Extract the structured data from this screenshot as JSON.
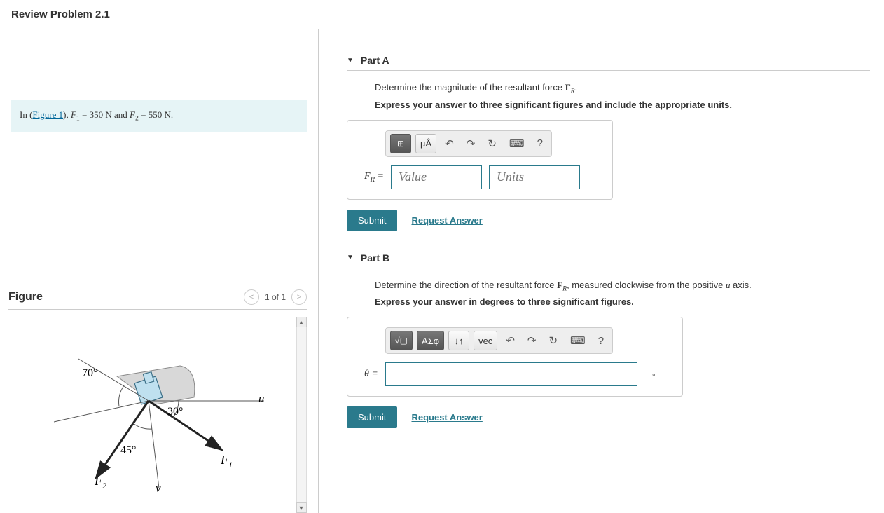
{
  "page_title": "Review Problem 2.1",
  "info": {
    "prefix": "In (",
    "figure_link": "Figure 1",
    "after_link": "), ",
    "f1_var": "F",
    "f1_sub": "1",
    "f1_eq": " = 350 N and ",
    "f2_var": "F",
    "f2_sub": "2",
    "f2_eq": " = 550 N."
  },
  "figure": {
    "heading": "Figure",
    "pager": "1 of 1",
    "angle1": "70°",
    "angle2": "30°",
    "angle3": "45°",
    "axis_u": "u",
    "axis_v": "v",
    "label_f1": "F",
    "label_f1_sub": "1",
    "label_f2": "F",
    "label_f2_sub": "2"
  },
  "parts": {
    "a": {
      "title": "Part A",
      "question_pre": "Determine the magnitude of the resultant force ",
      "question_var": "F",
      "question_sub": "R",
      "question_post": ".",
      "instruction": "Express your answer to three significant figures and include the appropriate units.",
      "toolbar": {
        "tpl": "⊞",
        "units_btn": "µÅ",
        "undo": "↶",
        "redo": "↷",
        "reset": "↻",
        "kbd": "⌨",
        "help": "?"
      },
      "eq_label_var": "F",
      "eq_label_sub": "R",
      "eq_label_eq": " =",
      "value_placeholder": "Value",
      "units_placeholder": "Units",
      "submit": "Submit",
      "request": "Request Answer"
    },
    "b": {
      "title": "Part B",
      "question_pre": "Determine the direction of the resultant force ",
      "question_var": "F",
      "question_sub": "R",
      "question_mid": ", measured clockwise from the positive ",
      "question_axis": "u",
      "question_post": " axis.",
      "instruction": "Express your answer in degrees to three significant figures.",
      "toolbar": {
        "sqrt": "√▢",
        "greek": "ΑΣφ",
        "arrows": "↓↑",
        "vec": "vec",
        "undo": "↶",
        "redo": "↷",
        "reset": "↻",
        "kbd": "⌨",
        "help": "?"
      },
      "eq_label": "θ =",
      "deg_unit": "∘",
      "submit": "Submit",
      "request": "Request Answer"
    }
  }
}
